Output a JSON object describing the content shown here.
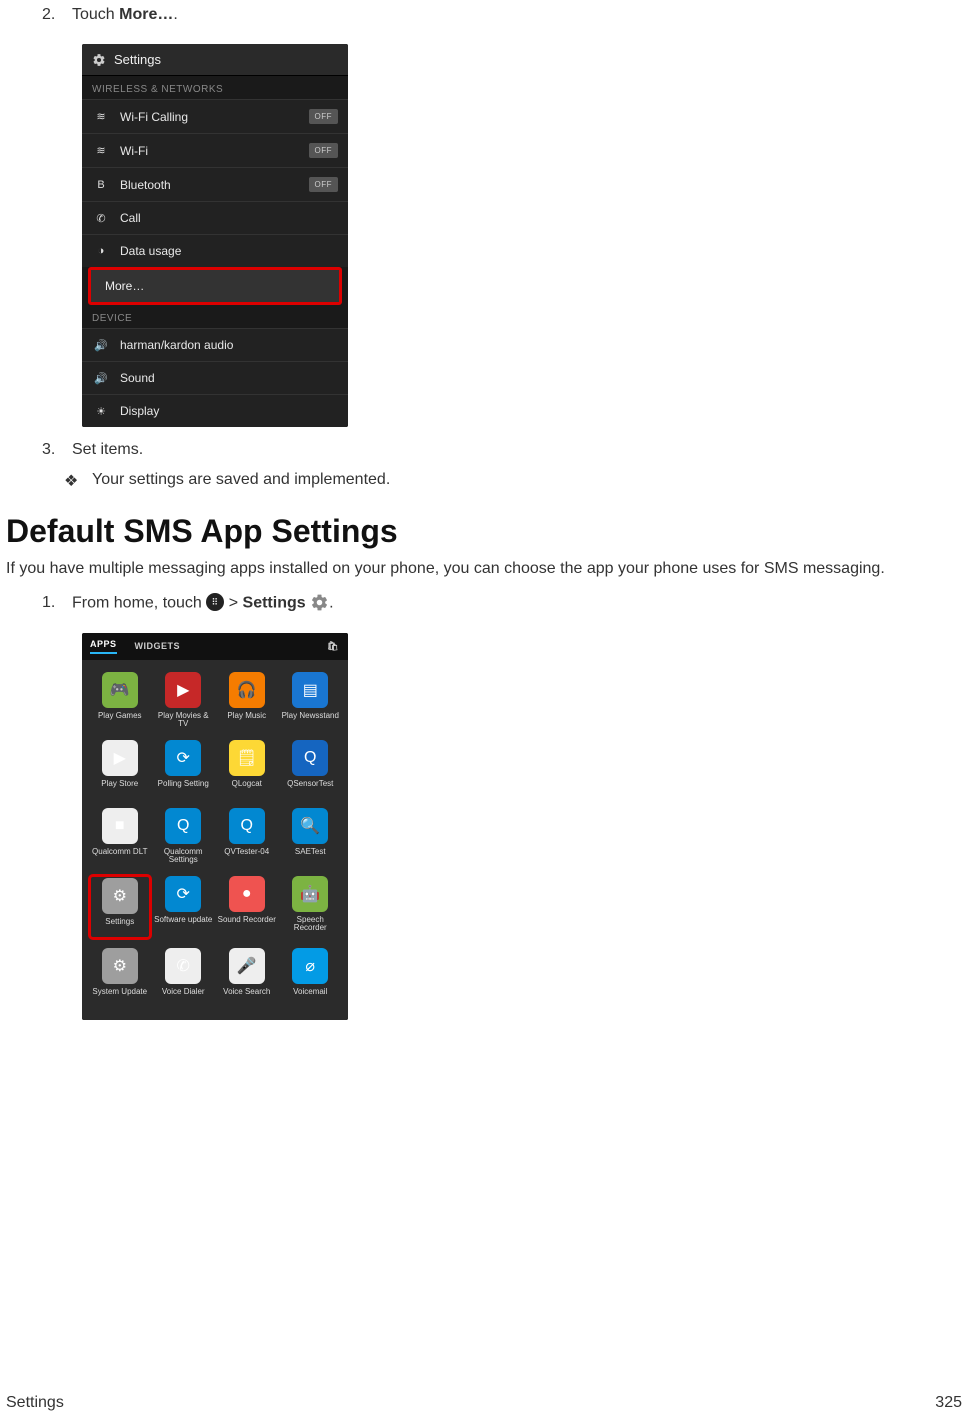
{
  "steps": {
    "s2_num": "2.",
    "s2_prefix": "Touch ",
    "s2_bold": "More…",
    "s2_suffix": ".",
    "s3_num": "3.",
    "s3_text": "Set items.",
    "bullet_sym": "❖",
    "bullet_text": "Your settings are saved and implemented.",
    "sms_1_num": "1.",
    "sms_1_a": "From home, touch ",
    "sms_1_b": " > ",
    "sms_1_bold": "Settings",
    "sms_1_c": " ",
    "sms_1_d": "."
  },
  "phone1": {
    "title": "Settings",
    "hdr1": "WIRELESS & NETWORKS",
    "rows1": [
      {
        "icon": "≋",
        "label": "Wi-Fi Calling",
        "toggle": "OFF"
      },
      {
        "icon": "≋",
        "label": "Wi-Fi",
        "toggle": "OFF"
      },
      {
        "icon": "B",
        "label": "Bluetooth",
        "toggle": "OFF"
      },
      {
        "icon": "✆",
        "label": "Call",
        "toggle": ""
      },
      {
        "icon": "◑",
        "label": "Data usage",
        "toggle": ""
      }
    ],
    "more": "More…",
    "hdr2": "DEVICE",
    "rows2": [
      {
        "icon": "🔊",
        "label": "harman/kardon audio"
      },
      {
        "icon": "🔊",
        "label": "Sound"
      },
      {
        "icon": "☀",
        "label": "Display"
      }
    ]
  },
  "section_title": "Default SMS App Settings",
  "section_body": "If you have multiple messaging apps installed on your phone, you can choose the app your phone uses for SMS messaging.",
  "phone2": {
    "tab_apps": "APPS",
    "tab_widgets": "WIDGETS",
    "apps": [
      {
        "name": "Play Games",
        "bg": "#7cb342",
        "sym": "🎮"
      },
      {
        "name": "Play Movies & TV",
        "bg": "#c62828",
        "sym": "▶"
      },
      {
        "name": "Play Music",
        "bg": "#f57c00",
        "sym": "🎧"
      },
      {
        "name": "Play Newsstand",
        "bg": "#1976d2",
        "sym": "▤"
      },
      {
        "name": "Play Store",
        "bg": "#eeeeee",
        "sym": "▶"
      },
      {
        "name": "Polling Setting",
        "bg": "#0288d1",
        "sym": "⟳"
      },
      {
        "name": "QLogcat",
        "bg": "#fdd835",
        "sym": "🗒"
      },
      {
        "name": "QSensorTest",
        "bg": "#1565c0",
        "sym": "Q"
      },
      {
        "name": "Qualcomm DLT",
        "bg": "#eeeeee",
        "sym": "■"
      },
      {
        "name": "Qualcomm Settings",
        "bg": "#0288d1",
        "sym": "Q"
      },
      {
        "name": "QVTester-04",
        "bg": "#0288d1",
        "sym": "Q"
      },
      {
        "name": "SAETest",
        "bg": "#0288d1",
        "sym": "🔍"
      },
      {
        "name": "Settings",
        "bg": "#9e9e9e",
        "sym": "⚙",
        "hl": true
      },
      {
        "name": "Software update",
        "bg": "#0288d1",
        "sym": "⟳"
      },
      {
        "name": "Sound Recorder",
        "bg": "#ef5350",
        "sym": "●"
      },
      {
        "name": "Speech Recorder",
        "bg": "#7cb342",
        "sym": "🤖"
      },
      {
        "name": "System Update",
        "bg": "#9e9e9e",
        "sym": "⚙"
      },
      {
        "name": "Voice Dialer",
        "bg": "#eeeeee",
        "sym": "✆"
      },
      {
        "name": "Voice Search",
        "bg": "#eeeeee",
        "sym": "🎤"
      },
      {
        "name": "Voicemail",
        "bg": "#039be5",
        "sym": "⌀"
      }
    ]
  },
  "footer": {
    "left": "Settings",
    "right": "325"
  }
}
